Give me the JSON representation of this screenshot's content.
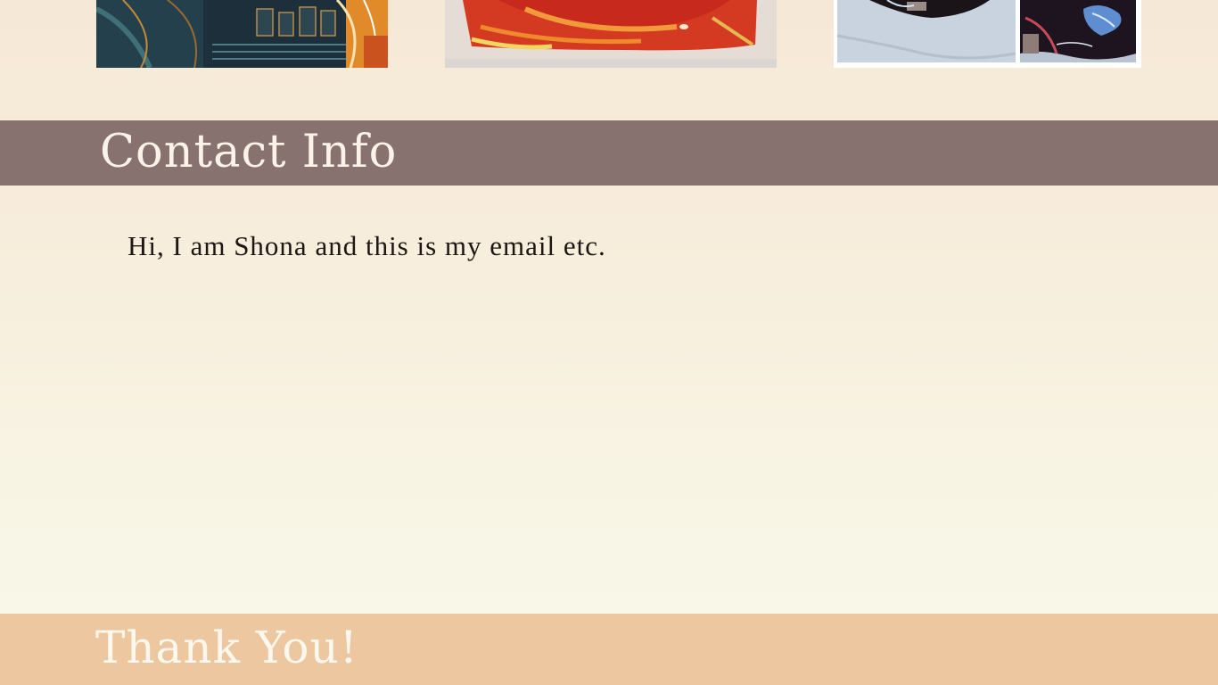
{
  "gallery": {
    "items": [
      {
        "icon": "abstract-painting-image"
      },
      {
        "icon": "red-painting-image"
      },
      {
        "icon": "painted-helmet-image"
      }
    ]
  },
  "contact": {
    "heading": "Contact Info",
    "text": "Hi, I am Shona and this is my email etc."
  },
  "footer": {
    "heading": "Thank You!"
  },
  "colors": {
    "contact_banner": "#877270",
    "footer_banner": "#edc79f",
    "page_top": "#f6e8d6",
    "page_bottom": "#faf9ea",
    "body_text": "#1e1614"
  }
}
